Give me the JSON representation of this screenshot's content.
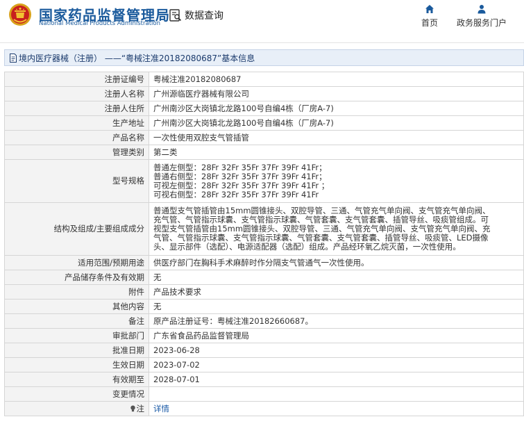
{
  "header": {
    "brand_cn": "国家药品监督管理局",
    "brand_en": "National Medical Products Administration",
    "query_label": "数据查询",
    "nav": {
      "home": "首页",
      "portal": "政务服务门户"
    }
  },
  "title": "境内医疗器械（注册） ——“粤械注准20182080687”基本信息",
  "rows": [
    {
      "key": "注册证编号",
      "value": "粤械注准20182080687"
    },
    {
      "key": "注册人名称",
      "value": "广州源临医疗器械有限公司"
    },
    {
      "key": "注册人住所",
      "value": "广州南沙区大岗镇北龙路100号自编4栋（厂房A-7)"
    },
    {
      "key": "生产地址",
      "value": "广州南沙区大岗镇北龙路100号自编4栋（厂房A-7)"
    },
    {
      "key": "产品名称",
      "value": "一次性使用双腔支气管插管"
    },
    {
      "key": "管理类别",
      "value": "第二类"
    },
    {
      "key": "型号规格",
      "value": "普通左侧型：28Fr 32Fr 35Fr 37Fr 39Fr 41Fr；\n普通右侧型：28Fr 32Fr 35Fr 37Fr 39Fr 41Fr；\n可视左侧型：28Fr 32Fr 35Fr 37Fr 39Fr 41Fr ；\n可视右侧型：28Fr 32Fr 35Fr 37Fr 39Fr 41Fr"
    },
    {
      "key": "结构及组成/主要组成成分",
      "value": "普通型支气管插管由15mm圆锥接头、双腔导管、三通、气管充气单向阀、支气管充气单向阀、\n充气管、气管指示球囊、支气管指示球囊、气管套囊、支气管套囊、插管导丝、吸痰管组成。可\n视型支气管插管由15mm圆锥接头、双腔导管、三通、气管充气单向阀、支气管充气单向阀、充\n气管、气管指示球囊、支气管指示球囊、气管套囊、支气管套囊、插管导丝、吸痰管、LED摄像\n头、显示部件（选配）、电源适配器（选配）组成。产品经环氧乙烷灭菌，一次性使用。"
    },
    {
      "key": "适用范围/预期用途",
      "value": "供医疗部门在胸科手术麻醉时作分隔支气管通气一次性使用。"
    },
    {
      "key": "产品储存条件及有效期",
      "value": "无"
    },
    {
      "key": "附件",
      "value": "产品技术要求"
    },
    {
      "key": "其他内容",
      "value": "无"
    },
    {
      "key": "备注",
      "value": "原产品注册证号：粤械注准20182660687。"
    },
    {
      "key": "审批部门",
      "value": "广东省食品药品监督管理局"
    },
    {
      "key": "批准日期",
      "value": "2023-06-28"
    },
    {
      "key": "生效日期",
      "value": "2023-07-02"
    },
    {
      "key": "有效期至",
      "value": "2028-07-01"
    },
    {
      "key": "变更情况",
      "value": ""
    },
    {
      "key": "注",
      "value": "详情"
    }
  ],
  "colors": {
    "brand": "#1a5a9c",
    "link": "#1a5aa6",
    "title_bg": "#e8eff8"
  },
  "icons": [
    "national-emblem-icon",
    "data-query-icon",
    "home-icon",
    "user-icon",
    "document-icon",
    "lightbulb-icon"
  ]
}
